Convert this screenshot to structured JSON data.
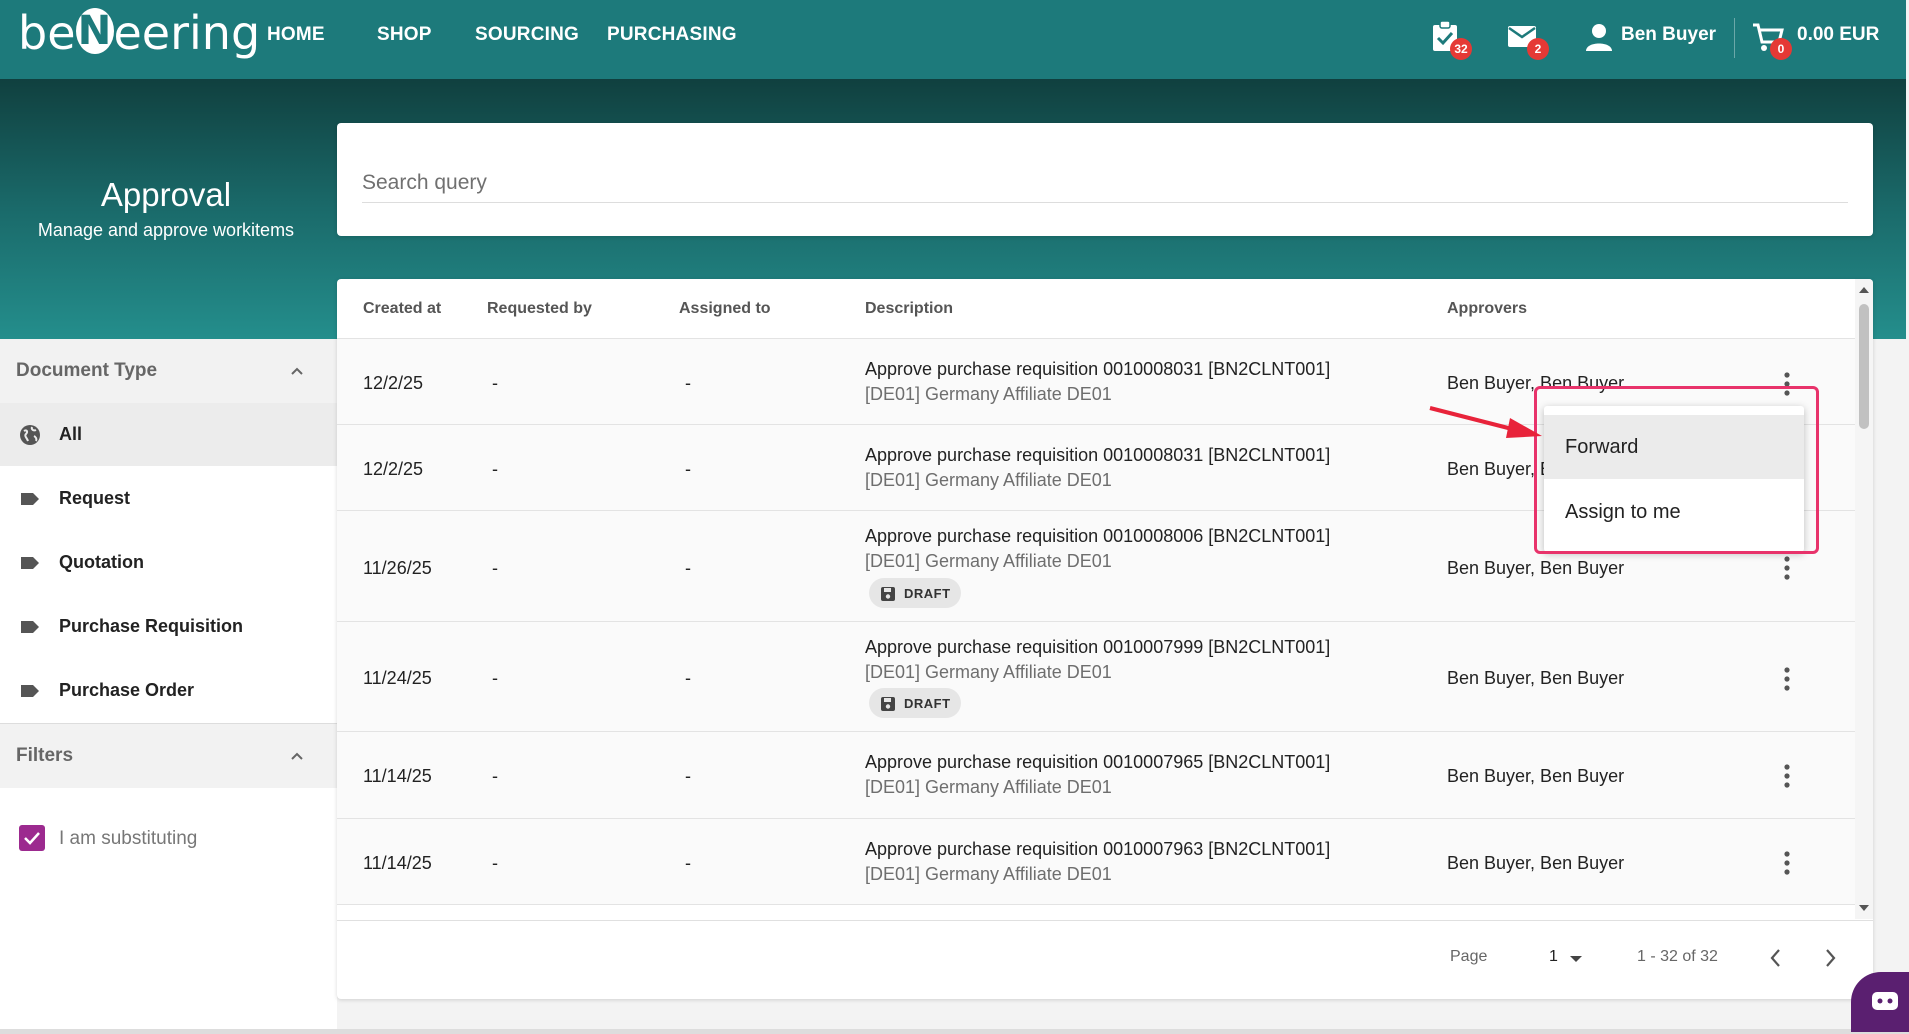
{
  "nav": {
    "logo_left": "be",
    "logo_n": "N",
    "logo_right": "eering",
    "links": [
      "HOME",
      "SHOP",
      "SOURCING",
      "PURCHASING"
    ],
    "tasks_badge": "32",
    "mail_badge": "2",
    "user_name": "Ben Buyer",
    "cart_badge": "0",
    "cart_total": "0.00 EUR",
    "brand_color": "#1d7a7b"
  },
  "hero": {
    "title": "Approval",
    "subtitle": "Manage and approve workitems"
  },
  "search": {
    "placeholder": "Search query",
    "value": ""
  },
  "sidebar": {
    "doc_type_title": "Document Type",
    "doc_types": [
      {
        "label": "All",
        "icon": "globe-icon",
        "active": true
      },
      {
        "label": "Request",
        "icon": "label-icon"
      },
      {
        "label": "Quotation",
        "icon": "label-icon"
      },
      {
        "label": "Purchase Requisition",
        "icon": "label-icon"
      },
      {
        "label": "Purchase Order",
        "icon": "label-icon"
      }
    ],
    "filters_title": "Filters",
    "substituting_label": "I am substituting",
    "substituting_checked": true,
    "accent_color": "#9c2a8f"
  },
  "table": {
    "headers": [
      "Created at",
      "Requested by",
      "Assigned to",
      "Description",
      "Approvers"
    ],
    "rows": [
      {
        "created": "12/2/25",
        "requested": "-",
        "assigned": "-",
        "desc": "Approve purchase requisition 0010008031 [BN2CLNT001]",
        "org": "[DE01] Germany Affiliate DE01",
        "draft": false,
        "approvers": "Ben Buyer, Ben Buyer"
      },
      {
        "created": "12/2/25",
        "requested": "-",
        "assigned": "-",
        "desc": "Approve purchase requisition 0010008031 [BN2CLNT001]",
        "org": "[DE01] Germany Affiliate DE01",
        "draft": false,
        "approvers": "Ben Buyer, B"
      },
      {
        "created": "11/26/25",
        "requested": "-",
        "assigned": "-",
        "desc": "Approve purchase requisition 0010008006 [BN2CLNT001]",
        "org": "[DE01] Germany Affiliate DE01",
        "draft": true,
        "approvers": "Ben Buyer, Ben Buyer"
      },
      {
        "created": "11/24/25",
        "requested": "-",
        "assigned": "-",
        "desc": "Approve purchase requisition 0010007999 [BN2CLNT001]",
        "org": "[DE01] Germany Affiliate DE01",
        "draft": true,
        "approvers": "Ben Buyer, Ben Buyer"
      },
      {
        "created": "11/14/25",
        "requested": "-",
        "assigned": "-",
        "desc": "Approve purchase requisition 0010007965 [BN2CLNT001]",
        "org": "[DE01] Germany Affiliate DE01",
        "draft": false,
        "approvers": "Ben Buyer, Ben Buyer"
      },
      {
        "created": "11/14/25",
        "requested": "-",
        "assigned": "-",
        "desc": "Approve purchase requisition 0010007963 [BN2CLNT001]",
        "org": "[DE01] Germany Affiliate DE01",
        "draft": false,
        "approvers": "Ben Buyer, Ben Buyer"
      }
    ],
    "draft_label": "DRAFT"
  },
  "pagination": {
    "page_label": "Page",
    "page_value": "1",
    "range": "1 - 32 of 32"
  },
  "context_menu": {
    "items": [
      "Forward",
      "Assign to me"
    ],
    "highlight_color": "#e8336b"
  }
}
